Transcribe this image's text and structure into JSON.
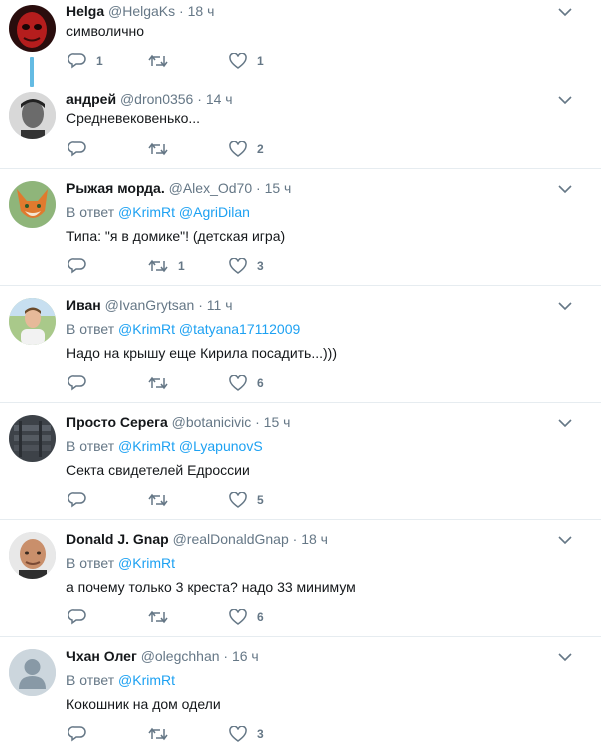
{
  "tweets": [
    {
      "name": "Helga",
      "handle": "@HelgaKs",
      "dot": "·",
      "time": "18 ч",
      "reply_label": "",
      "mentions": [],
      "text": "символично",
      "reply_count": "1",
      "retweet_count": "",
      "like_count": "1",
      "avatar_icon": "red-mask-avatar"
    },
    {
      "name": "андрей",
      "handle": "@dron0356",
      "dot": "·",
      "time": "14 ч",
      "reply_label": "",
      "mentions": [],
      "text": "Средневековенько...",
      "reply_count": "",
      "retweet_count": "",
      "like_count": "2",
      "avatar_icon": "man-portrait-avatar"
    },
    {
      "name": "Рыжая морда.",
      "handle": "@Alex_Od70",
      "dot": "·",
      "time": "15 ч",
      "reply_label": "В ответ",
      "mentions": [
        "@KrimRt",
        "@AgriDilan"
      ],
      "text": "Типа: \"я в домике\"! (детская игра)",
      "reply_count": "",
      "retweet_count": "1",
      "like_count": "3",
      "avatar_icon": "fox-avatar"
    },
    {
      "name": "Иван",
      "handle": "@IvanGrytsan",
      "dot": "·",
      "time": "11 ч",
      "reply_label": "В ответ",
      "mentions": [
        "@KrimRt",
        "@tatyana17112009"
      ],
      "text": "Надо на крышу еще Кирила посадить...)))",
      "reply_count": "",
      "retweet_count": "",
      "like_count": "6",
      "avatar_icon": "man-outdoors-avatar"
    },
    {
      "name": "Просто Серега",
      "handle": "@botanicivic",
      "dot": "·",
      "time": "15 ч",
      "reply_label": "В ответ",
      "mentions": [
        "@KrimRt",
        "@LyapunovS"
      ],
      "text": "Секта свидетелей Едроссии",
      "reply_count": "",
      "retweet_count": "",
      "like_count": "5",
      "avatar_icon": "dark-photo-avatar"
    },
    {
      "name": "Donald J. Gnap",
      "handle": "@realDonaldGnap",
      "dot": "·",
      "time": "18 ч",
      "reply_label": "В ответ",
      "mentions": [
        "@KrimRt"
      ],
      "text": "а почему только 3 креста? надо 33 минимум",
      "reply_count": "",
      "retweet_count": "",
      "like_count": "6",
      "avatar_icon": "bald-man-avatar"
    },
    {
      "name": "Чхан Олег",
      "handle": "@olegchhan",
      "dot": "·",
      "time": "16 ч",
      "reply_label": "В ответ",
      "mentions": [
        "@KrimRt"
      ],
      "text": "Кокошник на дом одели",
      "reply_count": "",
      "retweet_count": "",
      "like_count": "3",
      "avatar_icon": "default-egg-avatar"
    }
  ],
  "colors": {
    "link": "#1da1f2",
    "muted": "#657786",
    "thread_line": "#64bbe3",
    "separator": "#e6ecf0"
  }
}
